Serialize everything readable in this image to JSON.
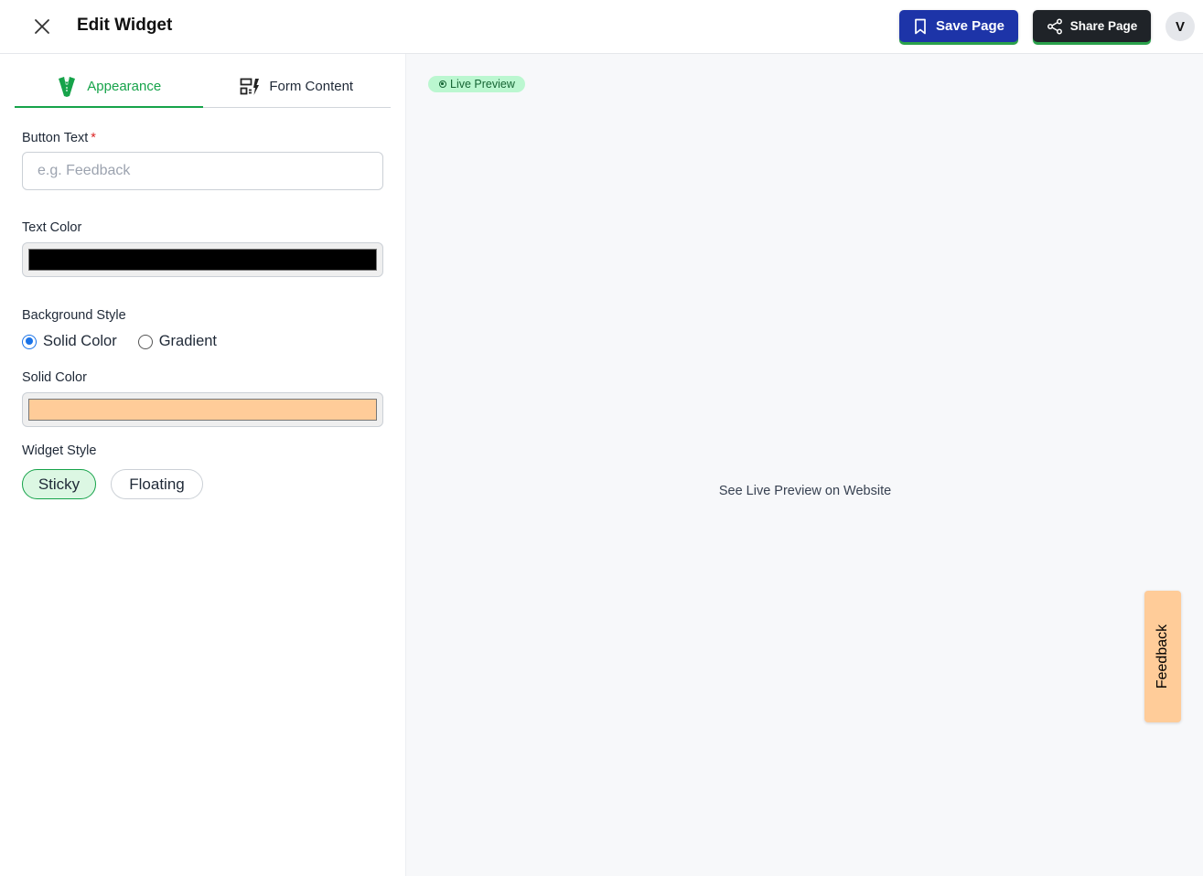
{
  "header": {
    "title": "Edit Widget",
    "save_label": "Save Page",
    "share_label": "Share Page",
    "avatar_initial": "V"
  },
  "tabs": [
    {
      "label": "Appearance",
      "icon": "tuxedo-icon",
      "active": true
    },
    {
      "label": "Form Content",
      "icon": "form-layout-icon",
      "active": false
    }
  ],
  "form": {
    "button_text": {
      "label": "Button Text",
      "required_mark": "*",
      "value": "",
      "placeholder": "e.g. Feedback"
    },
    "text_color": {
      "label": "Text Color",
      "value": "#000000"
    },
    "background_style": {
      "label": "Background Style",
      "options": [
        "Solid Color",
        "Gradient"
      ],
      "selected": "Solid Color"
    },
    "solid_color": {
      "label": "Solid Color",
      "value": "#ffcc99"
    },
    "widget_style": {
      "label": "Widget Style",
      "options": [
        "Sticky",
        "Floating"
      ],
      "selected": "Sticky"
    }
  },
  "preview": {
    "badge": "Live Preview",
    "message": "See Live Preview on Website",
    "widget_label": "Feedback",
    "widget_bg": "#ffcc99",
    "widget_text_color": "#000000"
  },
  "colors": {
    "accent_green": "#16a34a",
    "save_blue": "#1d34a8",
    "share_dark": "#1f2328"
  }
}
